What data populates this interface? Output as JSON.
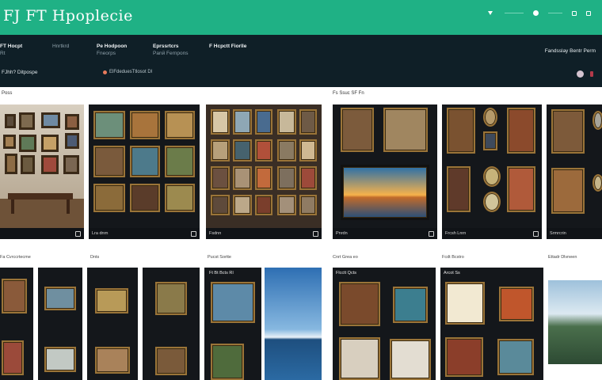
{
  "header": {
    "brand": "FЈ FT Hpoplecie",
    "nav": [
      {
        "icon": "chevron-down-icon",
        "label": ""
      },
      {
        "icon": "dot-icon",
        "label": "————"
      },
      {
        "icon": "user-icon",
        "label": ""
      },
      {
        "icon": "list-icon",
        "label": "———"
      },
      {
        "icon": "bag-icon",
        "label": ""
      },
      {
        "icon": "cart-icon",
        "label": ""
      }
    ]
  },
  "menu": [
    {
      "title": "FT Hocpt",
      "sub": "Rt"
    },
    {
      "title": "",
      "sub": "Hnrtkrd"
    },
    {
      "title": "Pe Hodpoon",
      "sub": "Fneoгрs"
    },
    {
      "title": "Eprssrtcrs",
      "sub": "Panй Fernpons"
    },
    {
      "title": "F Hcpctt Fiorlle",
      "sub": ""
    }
  ],
  "account": "Fandsslay Bentr Perm",
  "filters": {
    "left": "FJhh?  Ditpospe",
    "mid": "ElFdeduesTtlosot Dl"
  },
  "sections": {
    "left": "Poss",
    "right": "Fs Ssuc SF Fn"
  },
  "cards": [
    {
      "meta": "",
      "below": "Fa Cvrccrtecme"
    },
    {
      "meta": "Lra dnrn",
      "below": "Dnts"
    },
    {
      "meta": "Fsdnn",
      "below": "Pucst Sortte"
    },
    {
      "meta": "Pnrdn",
      "below": "Cnrt Grea eo"
    },
    {
      "meta": "Frcsh Lnrn",
      "below": "Fcdt Bcstro"
    },
    {
      "meta": "Srmrcrin",
      "below": "Ettadr Dlvneen"
    }
  ],
  "row2": [
    {
      "label": "Ft Bt Bcts Rí"
    },
    {
      "label": "Flcctt Qcts"
    },
    {
      "label": "Arcot Ss"
    }
  ],
  "colors": {
    "accent": "#1fb185",
    "header": "#0f1f27",
    "frame": "#9a7438"
  }
}
